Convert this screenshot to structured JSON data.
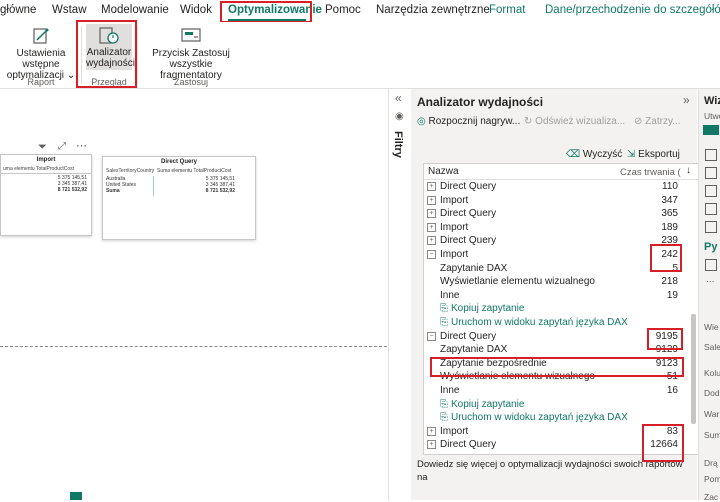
{
  "ribbon_tabs": {
    "home": "główne",
    "insert": "Wstaw",
    "modeling": "Modelowanie",
    "view": "Widok",
    "optimize": "Optymalizowanie",
    "help": "Pomoc",
    "external_tools": "Narzędzia zewnętrzne",
    "format": "Format",
    "data_drill": "Dane/przechodzenie do szczegółów"
  },
  "ribbon": {
    "page_refresh": "Ustawienia wstępne optymalizacji",
    "page_refresh_line1": "Ustawienia wstępne",
    "page_refresh_line2": "optymalizacji",
    "group_report": "Raport",
    "analyzer_line1": "Analizator",
    "analyzer_line2": "wydajności",
    "group_review": "Przegląd",
    "apply_all_line1": "Przycisk Zastosuj wszystkie",
    "apply_all_line2": "fragmentatory",
    "group_apply": "Zastosuj"
  },
  "canvas": {
    "visual1": {
      "title": "Import",
      "header": "uma elementu TotalProductCost",
      "rows": [
        "5 375 145,51",
        "3 345 387,41",
        "8 721 532,92"
      ]
    },
    "visual2": {
      "title": "Direct Query",
      "col1": "SalesTerritoryCountry",
      "col2": "Suma elementu TotalProductCost",
      "rows": [
        {
          "name": "Australia",
          "value": "5 375 145,51"
        },
        {
          "name": "United States",
          "value": "3 345 387,41"
        },
        {
          "name": "Suma",
          "value": "8 721 532,92"
        }
      ]
    }
  },
  "filters": {
    "label": "Filtry"
  },
  "analyzer": {
    "title": "Analizator wydajności",
    "start": "Rozpocznij nagryw...",
    "refresh": "Odśwież wizualiza...",
    "stop": "Zatrzy...",
    "clear": "Wyczyść",
    "export": "Eksportuj",
    "col_name": "Nazwa",
    "col_time": "Czas trwania (",
    "rows": [
      {
        "type": "group",
        "label": "Direct Query",
        "value": "110"
      },
      {
        "type": "group",
        "label": "Import",
        "value": "347"
      },
      {
        "type": "group",
        "label": "Direct Query",
        "value": "365"
      },
      {
        "type": "group",
        "label": "Import",
        "value": "189"
      },
      {
        "type": "group",
        "label": "Direct Query",
        "value": "239"
      },
      {
        "type": "open",
        "label": "Import",
        "value": "242"
      },
      {
        "type": "child",
        "label": "Zapytanie DAX",
        "value": "5"
      },
      {
        "type": "child",
        "label": "Wyświetlanie elementu wizualnego",
        "value": "218"
      },
      {
        "type": "child",
        "label": "Inne",
        "value": "19"
      },
      {
        "type": "link",
        "label": "Kopiuj zapytanie",
        "value": ""
      },
      {
        "type": "link",
        "label": "Uruchom w widoku zapytań języka DAX",
        "value": ""
      },
      {
        "type": "open",
        "label": "Direct Query",
        "value": "9195"
      },
      {
        "type": "child",
        "label": "Zapytanie DAX",
        "value": "9129"
      },
      {
        "type": "child",
        "label": "Zapytanie bezpośrednie",
        "value": "9123"
      },
      {
        "type": "child",
        "label": "Wyświetlanie elementu wizualnego",
        "value": "51"
      },
      {
        "type": "child",
        "label": "Inne",
        "value": "16"
      },
      {
        "type": "link",
        "label": "Kopiuj zapytanie",
        "value": ""
      },
      {
        "type": "link",
        "label": "Uruchom w widoku zapytań języka DAX",
        "value": ""
      },
      {
        "type": "group",
        "label": "Import",
        "value": "83"
      },
      {
        "type": "group",
        "label": "Direct Query",
        "value": "12664"
      },
      {
        "type": "group",
        "label": "Import",
        "value": ""
      }
    ],
    "footer": "Dowiedz się więcej o optymalizacji wydajności swoich raportów na"
  },
  "viz_pane": {
    "title": "Wiz",
    "build": "Utwó",
    "py": "Py",
    "wie": "Wie",
    "sale": "Sale",
    "kolu": "Kolu",
    "dod": "Dod",
    "war": "War",
    "sum": "Sum",
    "dra": "Drą",
    "pom": "Pom",
    "zac": "Zac"
  }
}
